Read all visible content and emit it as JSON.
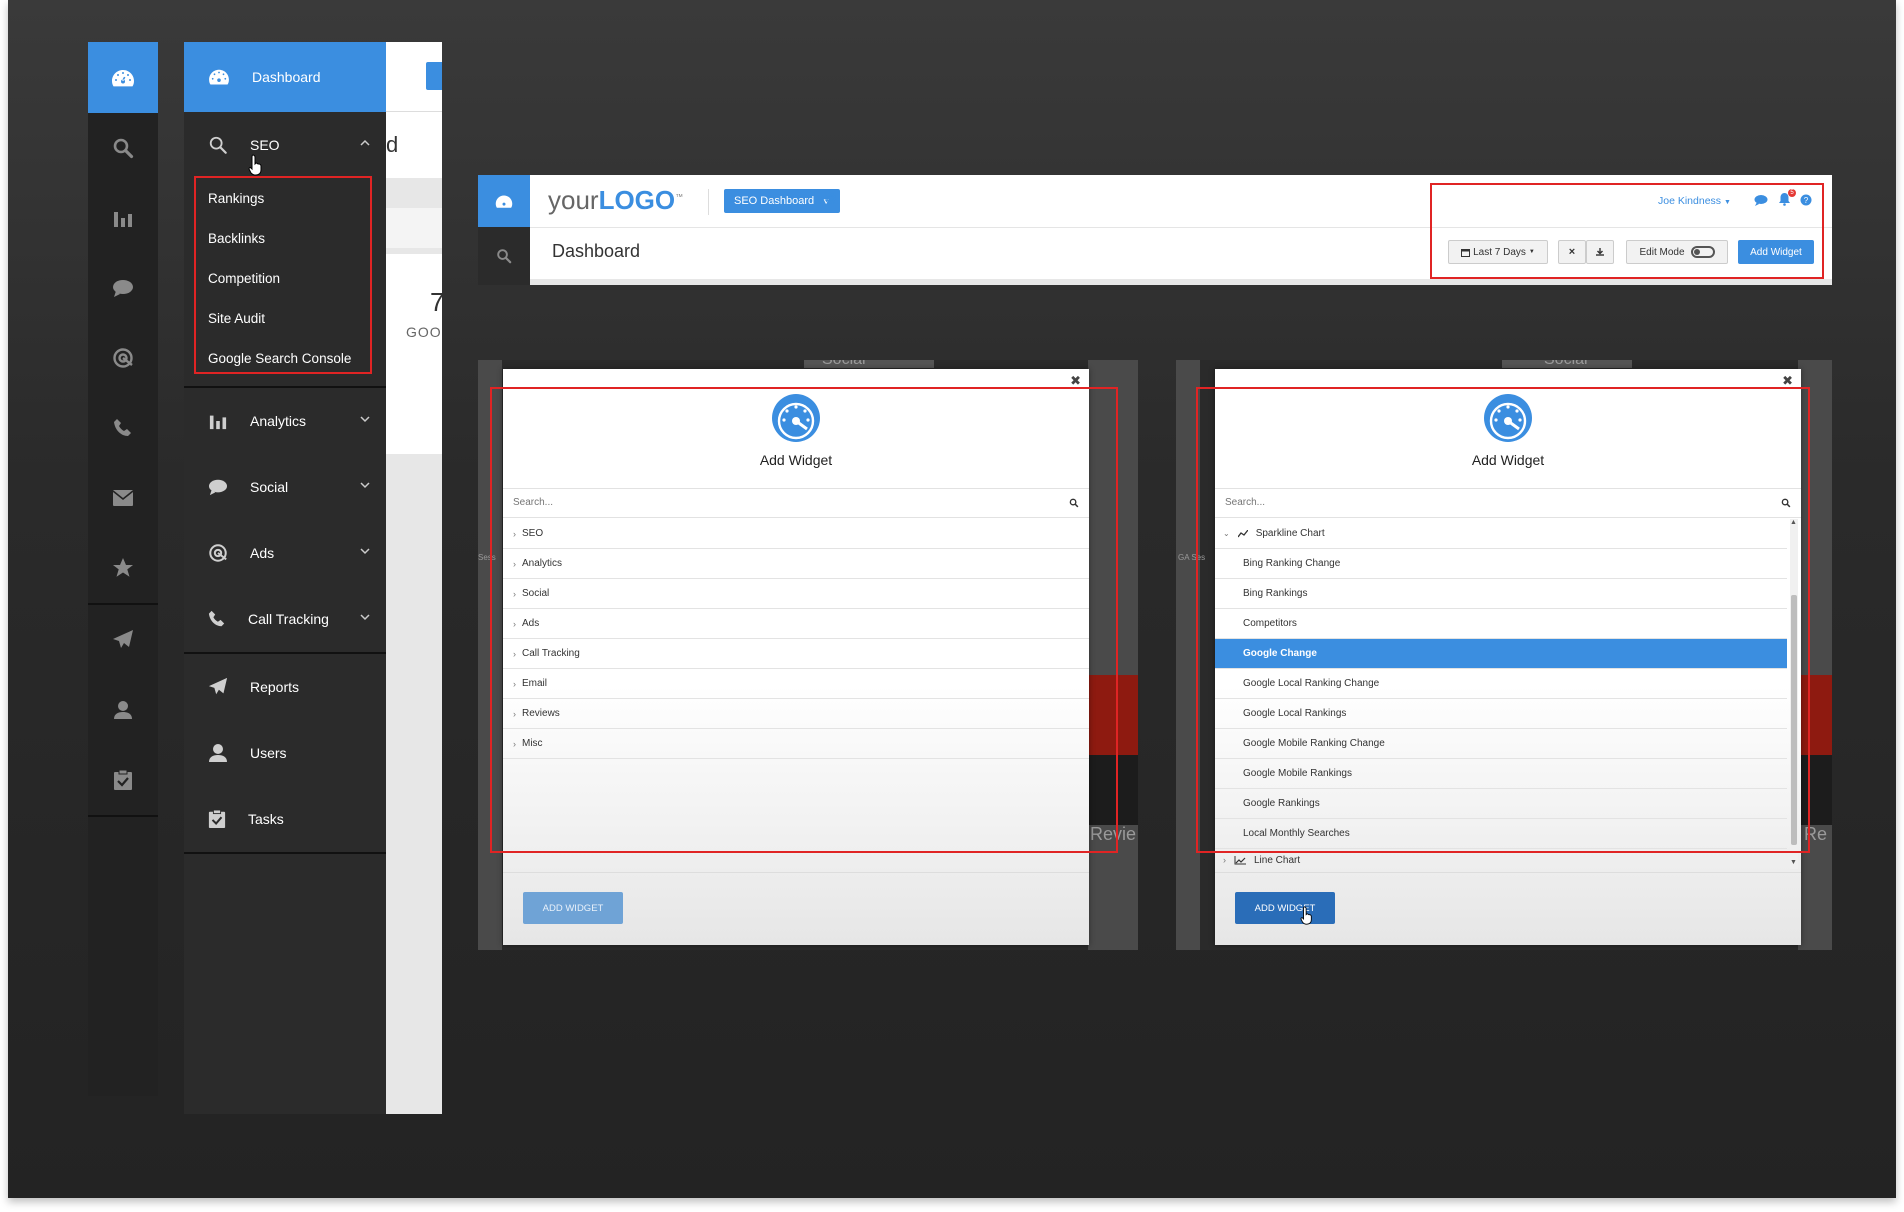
{
  "sidebar": {
    "dashboard": "Dashboard",
    "seo": "SEO",
    "seo_sub": [
      "Rankings",
      "Backlinks",
      "Competition",
      "Site Audit",
      "Google Search Console"
    ],
    "analytics": "Analytics",
    "social": "Social",
    "ads": "Ads",
    "call_tracking": "Call Tracking",
    "reports": "Reports",
    "users": "Users",
    "tasks": "Tasks"
  },
  "behind": {
    "frag_title": "d",
    "frag_num": "7",
    "frag_word": "GOO"
  },
  "header": {
    "logo_pre": "your",
    "logo_main": "LOGO",
    "logo_tm": "™",
    "dashboard_btn": "SEO Dashboard",
    "page_title": "Dashboard",
    "user": "Joe Kindness",
    "badge": "5",
    "date_range": "Last 7 Days",
    "edit_mode": "Edit Mode",
    "add_widget": "Add Widget"
  },
  "modal1": {
    "title": "Add Widget",
    "search_placeholder": "Search...",
    "categories": [
      "SEO",
      "Analytics",
      "Social",
      "Ads",
      "Call Tracking",
      "Email",
      "Reviews",
      "Misc"
    ],
    "button": "ADD WIDGET",
    "bg_top": "Social",
    "bg_left": "Sess",
    "bg_right": "Revie"
  },
  "modal2": {
    "title": "Add Widget",
    "search_placeholder": "Search...",
    "group": "Sparkline Chart",
    "items": [
      "Bing Ranking Change",
      "Bing Rankings",
      "Competitors",
      "Google Change",
      "Google Local Ranking Change",
      "Google Local Rankings",
      "Google Mobile Ranking Change",
      "Google Mobile Rankings",
      "Google Rankings",
      "Local Monthly Searches"
    ],
    "selected": "Google Change",
    "next_group": "Line Chart",
    "button": "ADD WIDGET",
    "bg_top": "Social",
    "bg_left": "GA Ses",
    "bg_right": "Re"
  },
  "colors": {
    "accent": "#3b8ee0",
    "highlight": "#e02424",
    "rail": "#222222",
    "sidebar": "#2b2b2b"
  }
}
